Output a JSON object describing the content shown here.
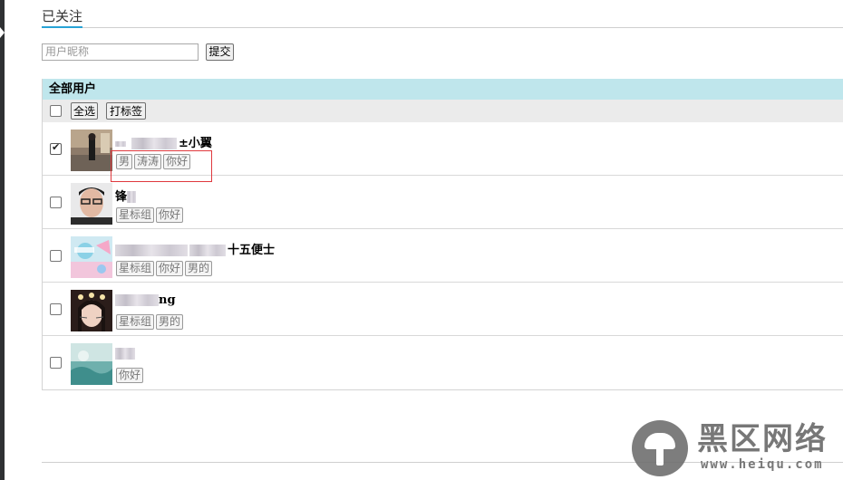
{
  "page": {
    "title": "已关注"
  },
  "search": {
    "placeholder": "用户昵称",
    "value": "",
    "submit_label": "提交"
  },
  "panel": {
    "header": "全部用户",
    "select_all_label": "全选",
    "tag_button_label": "打标签"
  },
  "users": [
    {
      "name_visible": "小翼",
      "checked": true,
      "tags": [
        "男",
        "涛涛",
        "你好"
      ]
    },
    {
      "name_visible": "",
      "checked": false,
      "tags": [
        "星标组",
        "你好"
      ]
    },
    {
      "name_visible": "五便士",
      "checked": false,
      "tags": [
        "星标组",
        "你好",
        "男的"
      ]
    },
    {
      "name_visible": "ng",
      "checked": false,
      "tags": [
        "星标组",
        "男的"
      ]
    },
    {
      "name_visible": "",
      "checked": false,
      "tags": [
        "你好"
      ]
    }
  ],
  "watermark": {
    "text": "黑区网络",
    "url": "www.heiqu.com"
  },
  "colors": {
    "accent": "#28a3d6",
    "panel_header": "#bfe6ec",
    "highlight": "#e0393e"
  }
}
